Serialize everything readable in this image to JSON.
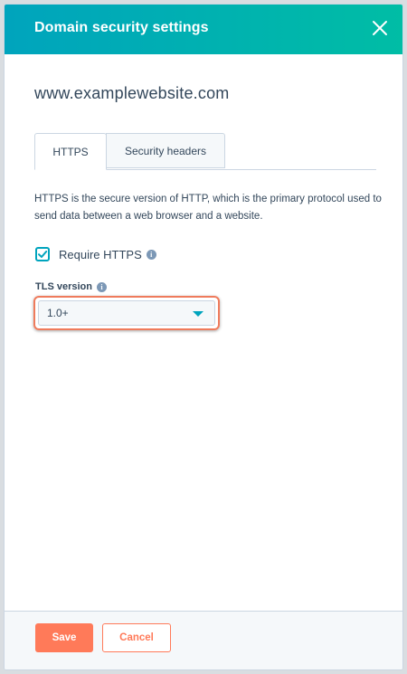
{
  "header": {
    "title": "Domain security settings"
  },
  "domain": "www.examplewebsite.com",
  "tabs": [
    {
      "label": "HTTPS",
      "active": true
    },
    {
      "label": "Security headers",
      "active": false
    }
  ],
  "https": {
    "description": "HTTPS is the secure version of HTTP, which is the primary protocol used to send data between a web browser and a website.",
    "require_label": "Require HTTPS",
    "require_checked": true,
    "tls_label": "TLS version",
    "tls_value": "1.0+"
  },
  "footer": {
    "save_label": "Save",
    "cancel_label": "Cancel"
  },
  "colors": {
    "header_start": "#00a4bd",
    "header_end": "#00bda5",
    "accent": "#00a4bd",
    "button": "#ff7a59",
    "highlight": "#ef7b5c"
  }
}
